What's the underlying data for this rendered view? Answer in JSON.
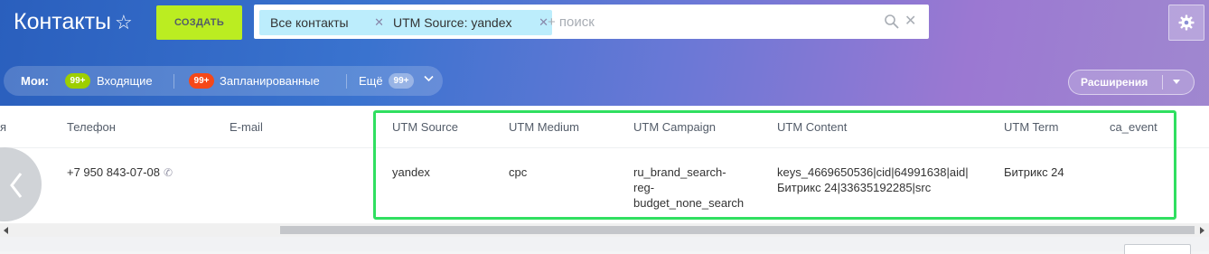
{
  "header": {
    "title": "Контакты",
    "create_label": "СОЗДАТЬ",
    "search_placeholder": "+ поиск",
    "filter_chips": [
      {
        "label": "Все контакты"
      },
      {
        "label": "UTM Source: yandex"
      }
    ]
  },
  "counters": {
    "mine_label": "Мои:",
    "items": [
      {
        "label": "Входящие",
        "badge": "99+",
        "badge_color": "#9dcf00"
      },
      {
        "label": "Запланированные",
        "badge": "99+",
        "badge_color": "#f54819"
      },
      {
        "label": "Ещё",
        "badge": "99+"
      }
    ]
  },
  "extensions_label": "Расширения",
  "grid": {
    "partial_left_header": "я",
    "columns": [
      "Телефон",
      "E-mail",
      "UTM Source",
      "UTM Medium",
      "UTM Campaign",
      "UTM Content",
      "UTM Term",
      "ca_event"
    ],
    "row": {
      "phone": "+7 950 843-07-08",
      "email": "",
      "utm_source": "yandex",
      "utm_medium": "cpc",
      "utm_campaign": [
        "ru_brand_search-",
        "reg-",
        "budget_none_search"
      ],
      "utm_content": [
        "keys_4669650536|cid|64991638|aid|",
        "Битрикс 24|33635192285|src"
      ],
      "utm_term": "Битрикс 24",
      "ca_event": ""
    }
  },
  "colors": {
    "accent_create": "#bbed21",
    "highlight_border": "#30df60",
    "chip_bg": "#bcedfc"
  }
}
